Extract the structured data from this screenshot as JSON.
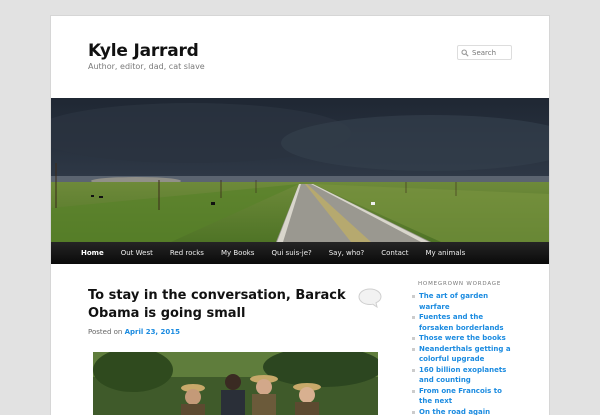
{
  "site": {
    "title": "Kyle Jarrard",
    "description": "Author, editor, dad, cat slave"
  },
  "search": {
    "placeholder": "Search"
  },
  "nav": {
    "items": [
      {
        "label": "Home",
        "active": true
      },
      {
        "label": "Out West"
      },
      {
        "label": "Red rocks"
      },
      {
        "label": "My Books"
      },
      {
        "label": "Qui suis-je?"
      },
      {
        "label": "Say, who?"
      },
      {
        "label": "Contact"
      },
      {
        "label": "My animals"
      }
    ]
  },
  "post": {
    "title": "To stay in the conversation, Barack Obama is going small",
    "posted_on": "Posted on",
    "date": "April 23, 2015"
  },
  "sidebar": {
    "widget_title": "Homegrown wordage",
    "links": [
      "The art of garden warfare",
      "Fuentes and the forsaken borderlands",
      "Those were the books",
      "Neanderthals getting a colorful upgrade",
      "160 billion exoplanets and counting",
      "From one Francois to the next",
      "On the road again"
    ]
  },
  "colors": {
    "link": "#1b8be0",
    "nav_bg": "#1a1a1a",
    "page_bg": "#e2e2e2"
  }
}
